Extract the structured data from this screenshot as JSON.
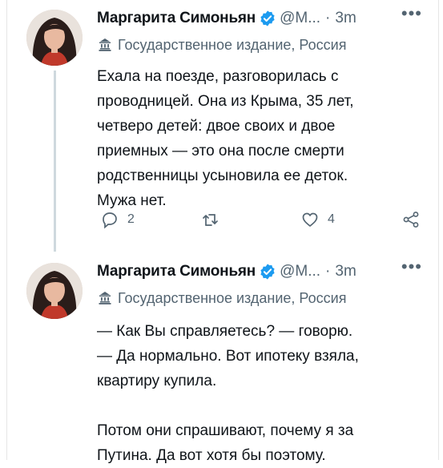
{
  "tweets": [
    {
      "author_name": "Маргарита Симоньян",
      "handle": "@M...",
      "separator": "·",
      "time": "3m",
      "more_icon": "more-icon",
      "label": "Государственное издание, Россия",
      "text": "Ехала на поезде, разговорилась с\nпроводницей. Она из Крыма, 35 лет,\nчетверо детей: двое своих и двое\nприемных — это она после смерти\nродственницы усыновила ее деток.\nМужа нет.",
      "reply_count": "2",
      "retweet_count": "",
      "like_count": "4"
    },
    {
      "author_name": "Маргарита Симоньян",
      "handle": "@M...",
      "separator": "·",
      "time": "3m",
      "more_icon": "more-icon",
      "label": "Государственное издание, Россия",
      "text": "— Как Вы справляетесь? — говорю.\n— Да нормально. Вот ипотеку взяла,\nквартиру купила.\n\nПотом они спрашивают, почему я за\nПутина. Да вот хотя бы поэтому."
    }
  ],
  "colors": {
    "text": "#0f1419",
    "secondary": "#536471",
    "verified": "#1d9bf0",
    "thread_line": "#cfd9de"
  },
  "icons": {
    "verified": "verified-badge-icon",
    "label": "government-building-icon",
    "reply": "reply-icon",
    "retweet": "retweet-icon",
    "like": "heart-icon",
    "share": "share-icon"
  }
}
